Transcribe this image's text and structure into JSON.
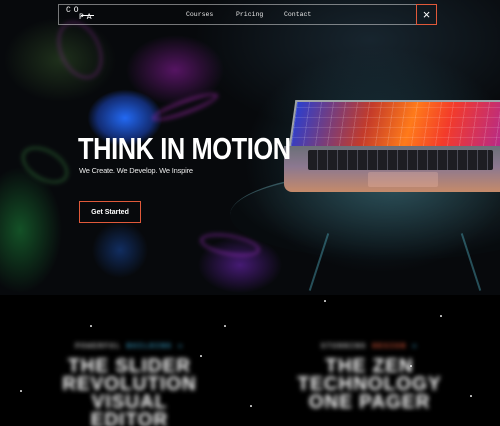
{
  "nav": {
    "logo_top": "CO",
    "logo_bottom": "PA",
    "links": [
      "Courses",
      "Pricing",
      "Contact"
    ],
    "close_icon": "×"
  },
  "hero": {
    "title": "THINK IN MOTION",
    "subtitle": "We Create. We Develop. We Inspire",
    "cta_label": "Get Started"
  },
  "slides": [
    {
      "kicker_prefix": "POWERFUL",
      "kicker_accent": "BUILDING",
      "kicker_suffix": "»",
      "title": "THE SLIDER\nREVOLUTION\nVISUAL EDITOR"
    },
    {
      "kicker_prefix": "STUNNING",
      "kicker_accent": "DESIGN",
      "kicker_suffix": "»",
      "title": "THE ZEN\nTECHNOLOGY\nONE PAGER"
    }
  ],
  "colors": {
    "accent": "#e0593a",
    "secondary_accent": "#3aa0c8",
    "background": "#000000"
  }
}
